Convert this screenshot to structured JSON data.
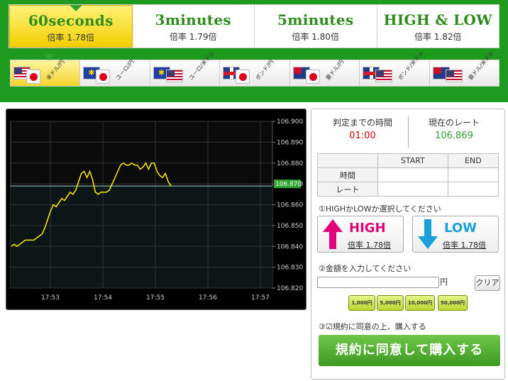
{
  "tabs": [
    {
      "title": "60seconds",
      "rate": "倍率 1.78倍"
    },
    {
      "title": "3minutes",
      "rate": "倍率 1.79倍"
    },
    {
      "title": "5minutes",
      "rate": "倍率 1.80倍"
    },
    {
      "title": "HIGH & LOW",
      "rate": "倍率 1.82倍"
    }
  ],
  "pairs": [
    {
      "label": "米ドル/円",
      "base": "us-flag-icon",
      "quote": "jp-flag-icon"
    },
    {
      "label": "ユーロ/円",
      "base": "eu-flag-icon",
      "quote": "jp-flag-icon"
    },
    {
      "label": "ユーロ/米ドル",
      "base": "eu-flag-icon",
      "quote": "us-flag-icon"
    },
    {
      "label": "ポンド/円",
      "base": "gb-flag-icon",
      "quote": "jp-flag-icon"
    },
    {
      "label": "豪ドル/円",
      "base": "au-flag-icon",
      "quote": "jp-flag-icon"
    },
    {
      "label": "ポンド/米ドル",
      "base": "gb-flag-icon",
      "quote": "us-flag-icon"
    },
    {
      "label": "豪ドル/米ドル",
      "base": "au-flag-icon",
      "quote": "us-flag-icon"
    }
  ],
  "chart_data": {
    "type": "line",
    "x_ticks": [
      "17:53",
      "17:54",
      "17:55",
      "17:56",
      "17:57"
    ],
    "y_ticks": [
      "106.900",
      "106.890",
      "106.880",
      "106.870",
      "106.860",
      "106.850",
      "106.840",
      "106.830",
      "106.820"
    ],
    "ylim": [
      106.82,
      106.9
    ],
    "current_label": "106.870",
    "series": [
      {
        "values": [
          106.84,
          106.841,
          106.84,
          106.841,
          106.842,
          106.843,
          106.843,
          106.843,
          106.843,
          106.844,
          106.845,
          106.846,
          106.849,
          106.853,
          106.857,
          106.86,
          106.859,
          106.861,
          106.863,
          106.862,
          106.864,
          106.866,
          106.865,
          106.867,
          106.871,
          106.875,
          106.876,
          106.873,
          106.876,
          106.872,
          106.866,
          106.865,
          106.866,
          106.866,
          106.866,
          106.867,
          106.87,
          106.873,
          106.876,
          106.879,
          106.88,
          106.879,
          106.879,
          106.88,
          106.879,
          106.879,
          106.877,
          106.878,
          106.88,
          106.877,
          106.88,
          106.88,
          106.876,
          106.874,
          106.873,
          106.875,
          106.871,
          106.869
        ],
        "color": "#ffee00"
      }
    ],
    "reference_line": 106.869
  },
  "info": {
    "time_label": "判定までの時間",
    "time_value": "01:00",
    "rate_label": "現在のレート",
    "rate_value": "106.869"
  },
  "result_table": {
    "headers": [
      "",
      "START",
      "END"
    ],
    "rows": [
      [
        "時間",
        "",
        ""
      ],
      [
        "レート",
        "",
        ""
      ]
    ]
  },
  "step1": "①HIGHかLOWか選択してください",
  "high_button": {
    "label": "HIGH",
    "rate": "倍率 1.78倍"
  },
  "low_button": {
    "label": "LOW",
    "rate": "倍率 1.78倍"
  },
  "step2": "②金額を入力してください",
  "amount": {
    "value": "",
    "unit": "円",
    "clear": "クリア"
  },
  "amount_buttons": [
    "1,000円",
    "5,000円",
    "10,000円",
    "50,000円"
  ],
  "step3": "③☑規約に同意の上、購入する",
  "agree_button": "規約に同意して購入する",
  "colors": {
    "header_green": "#1e9b1e",
    "time_red": "#d40000",
    "rate_green": "#2ea02e",
    "high_pink": "#e0007a",
    "low_blue": "#1aa0d8",
    "line_yellow": "#ffee00"
  }
}
